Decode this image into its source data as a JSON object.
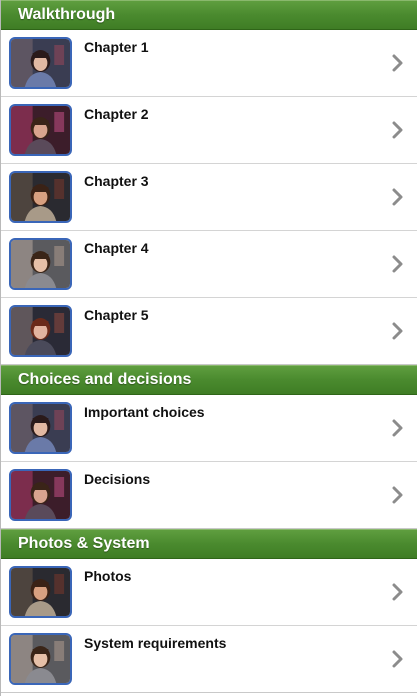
{
  "sections": [
    {
      "title": "Walkthrough",
      "items": [
        {
          "label": "Chapter 1",
          "thumb": "scene-a"
        },
        {
          "label": "Chapter 2",
          "thumb": "scene-b"
        },
        {
          "label": "Chapter 3",
          "thumb": "scene-c"
        },
        {
          "label": "Chapter 4",
          "thumb": "scene-d"
        },
        {
          "label": "Chapter 5",
          "thumb": "scene-e"
        }
      ]
    },
    {
      "title": "Choices and decisions",
      "items": [
        {
          "label": "Important choices",
          "thumb": "scene-a"
        },
        {
          "label": "Decisions",
          "thumb": "scene-b"
        }
      ]
    },
    {
      "title": "Photos & System",
      "items": [
        {
          "label": "Photos",
          "thumb": "scene-c"
        },
        {
          "label": "System requirements",
          "thumb": "scene-d"
        }
      ]
    }
  ],
  "icons": {
    "chevron": "chevron-right-icon"
  },
  "colors": {
    "header_green": "#4a8a2e",
    "thumb_border": "#3a66b8",
    "chevron": "#8c8c8c"
  }
}
